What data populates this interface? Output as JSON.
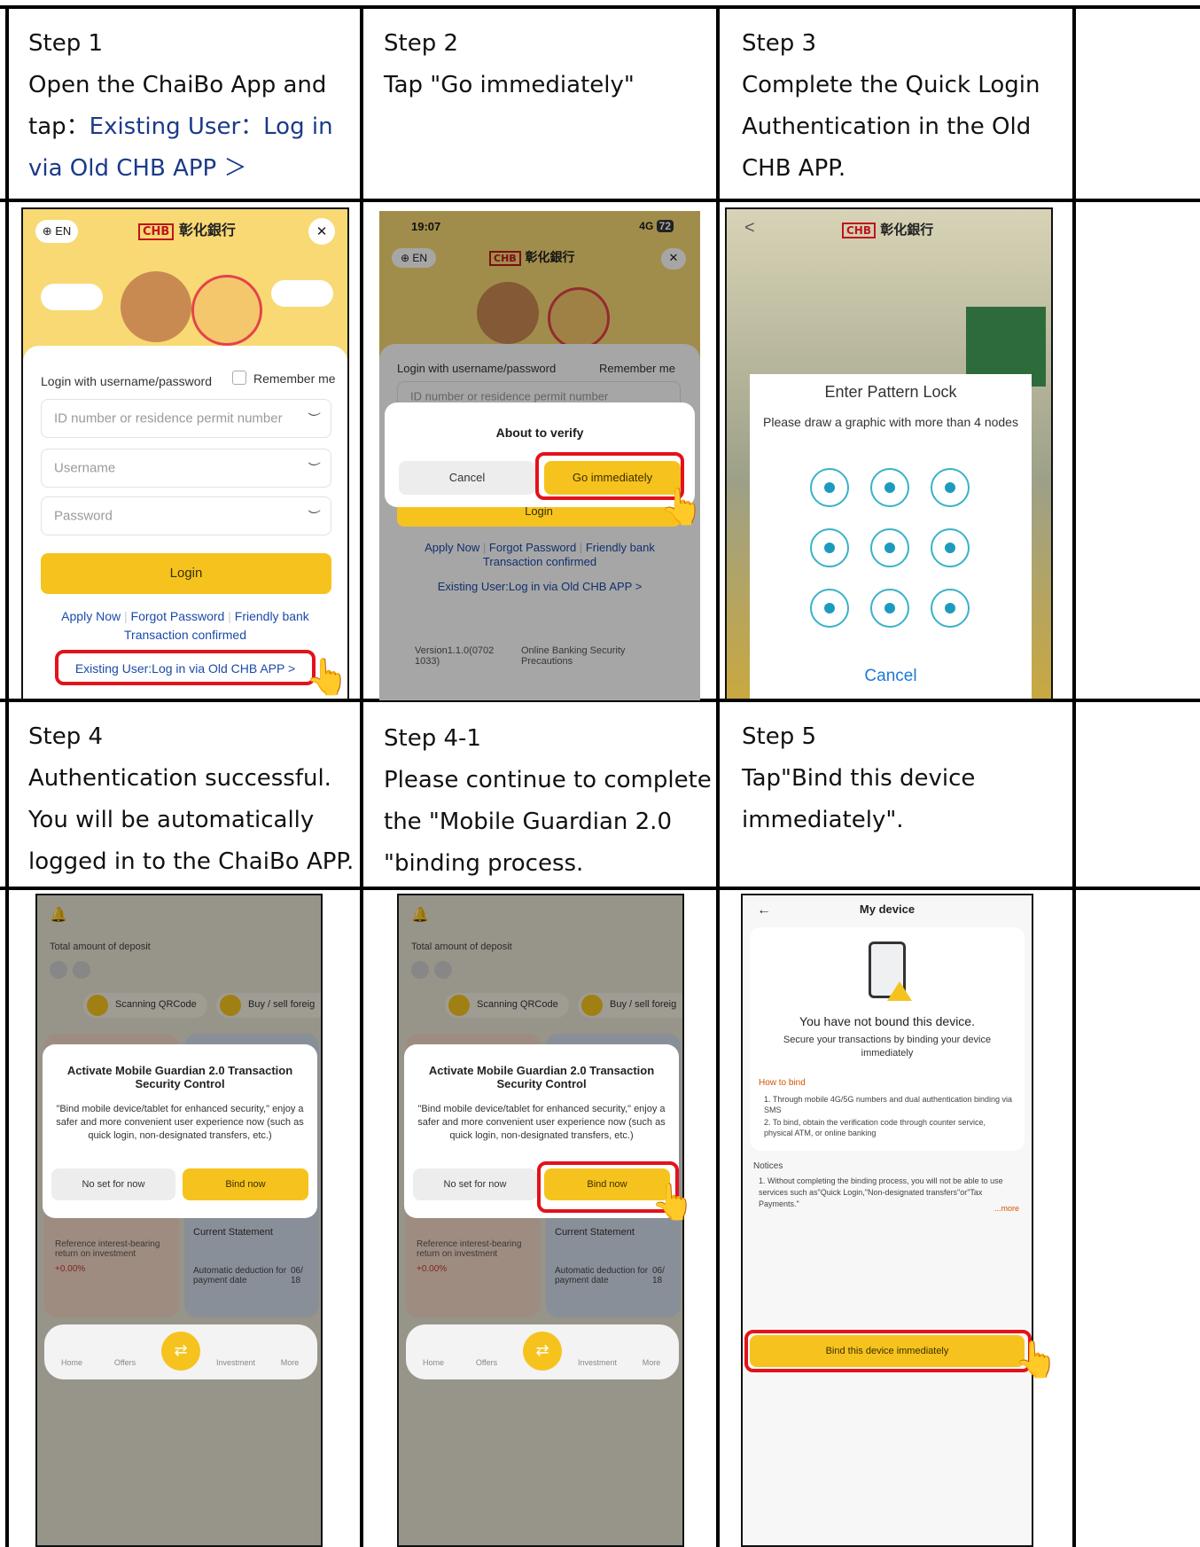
{
  "steps": {
    "s1": {
      "title": "Step 1",
      "line1": "Open the ChaiBo App and",
      "line2_prefix": "tap：",
      "line2_link": "Existing User：Log in",
      "line3_link": "via Old CHB APP ＞"
    },
    "s2": {
      "title": "Step 2",
      "line1": "Tap \"Go immediately\""
    },
    "s3": {
      "title": "Step 3",
      "line1": "Complete the Quick Login",
      "line2": "Authentication in the Old",
      "line3": "CHB APP."
    },
    "s4": {
      "title": "Step 4",
      "line1": "Authentication successful.",
      "line2": "You will be automatically",
      "line3": "logged in to the ChaiBo APP."
    },
    "s41": {
      "title": "Step 4-1",
      "line1": "Please continue to complete",
      "line2": "the \"Mobile Guardian 2.0",
      "line3": "\"binding process."
    },
    "s5": {
      "title": "Step 5",
      "line1": "Tap\"Bind this device",
      "line2": "immediately\"."
    }
  },
  "login_screen": {
    "lang": "⊕ EN",
    "bank_logo_text": "CHB",
    "bank_name": "彰化銀行",
    "close": "✕",
    "login_with": "Login with username/password",
    "remember_me": "Remember me",
    "id_placeholder": "ID number or residence permit number",
    "username_placeholder": "Username",
    "password_placeholder": "Password",
    "login_button": "Login",
    "apply_now": "Apply Now",
    "forgot_password": "Forgot Password",
    "friendly_bank": "Friendly bank",
    "transaction_confirmed": "Transaction confirmed",
    "existing_user": "Existing User:Log in via Old CHB APP >"
  },
  "verify_screen": {
    "time": "19:07",
    "signal": "4G",
    "battery": "72",
    "about_to_verify": "About to verify",
    "cancel": "Cancel",
    "go_immediately": "Go immediately",
    "login": "Login",
    "version": "Version1.1.0(0702 1033)",
    "security": "Online Banking Security Precautions"
  },
  "pattern_screen": {
    "back": "<",
    "title": "Enter Pattern Lock",
    "subtitle": "Please draw a graphic with more than 4 nodes",
    "cancel": "Cancel"
  },
  "home_screen": {
    "total_deposit": "Total amount of deposit",
    "scanning": "Scanning QRCode",
    "buy_sell": "Buy / sell foreig",
    "modal_title": "Activate Mobile Guardian 2.0 Transaction Security Control",
    "modal_body": "\"Bind mobile device/tablet for enhanced security,\" enjoy a safer and more convenient user experience now (such as quick login, non-designated transfers, etc.)",
    "no_set": "No set for now",
    "bind_now": "Bind now",
    "reference": "Reference interest-bearing return on investment",
    "rate": "+0.00%",
    "current_statement": "Current Statement",
    "auto_deduction": "Automatic deduction for payment date",
    "date": "06/ 18",
    "tabs": [
      "Home",
      "Offers",
      "Investment",
      "More"
    ]
  },
  "device_screen": {
    "back": "←",
    "title": "My device",
    "not_bound": "You have not bound this device.",
    "secure": "Secure your transactions by binding your device immediately",
    "how_to_bind": "How to bind",
    "how1": "1. Through mobile 4G/5G numbers and dual authentication binding via SMS",
    "how2": "2. To bind, obtain the verification code through counter service, physical ATM, or online banking",
    "notices": "Notices",
    "notice1": "1. Without completing the binding process, you will not be able to use services such as\"Quick Login,\"Non-designated transfers\"or\"Tax Payments.\"",
    "more": "...more",
    "bind_button": "Bind this device immediately"
  },
  "colors": {
    "accent_yellow": "#f6c31e",
    "highlight_red": "#e3121b",
    "link_blue": "#1b3a8a",
    "teal": "#38b2c8"
  },
  "icons": [
    "globe-icon",
    "close-icon",
    "eye-closed-icon",
    "pointing-hand-icon",
    "bell-icon",
    "qr-icon",
    "transfer-icon",
    "phone-warning-icon",
    "back-arrow-icon"
  ]
}
